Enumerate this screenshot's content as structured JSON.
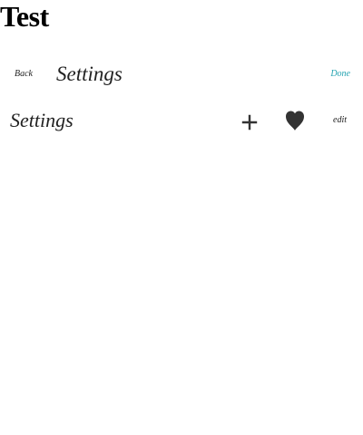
{
  "page": {
    "title": "Test"
  },
  "navbar": {
    "back_label": "Back",
    "title": "Settings",
    "done_label": "Done"
  },
  "toolbar": {
    "title": "Settings",
    "add_icon": "plus-icon",
    "favorite_icon": "heart-icon",
    "edit_label": "edit"
  },
  "colors": {
    "done_accent": "#25a3b1",
    "text": "#222222",
    "icon": "#333333",
    "background": "#ffffff"
  }
}
